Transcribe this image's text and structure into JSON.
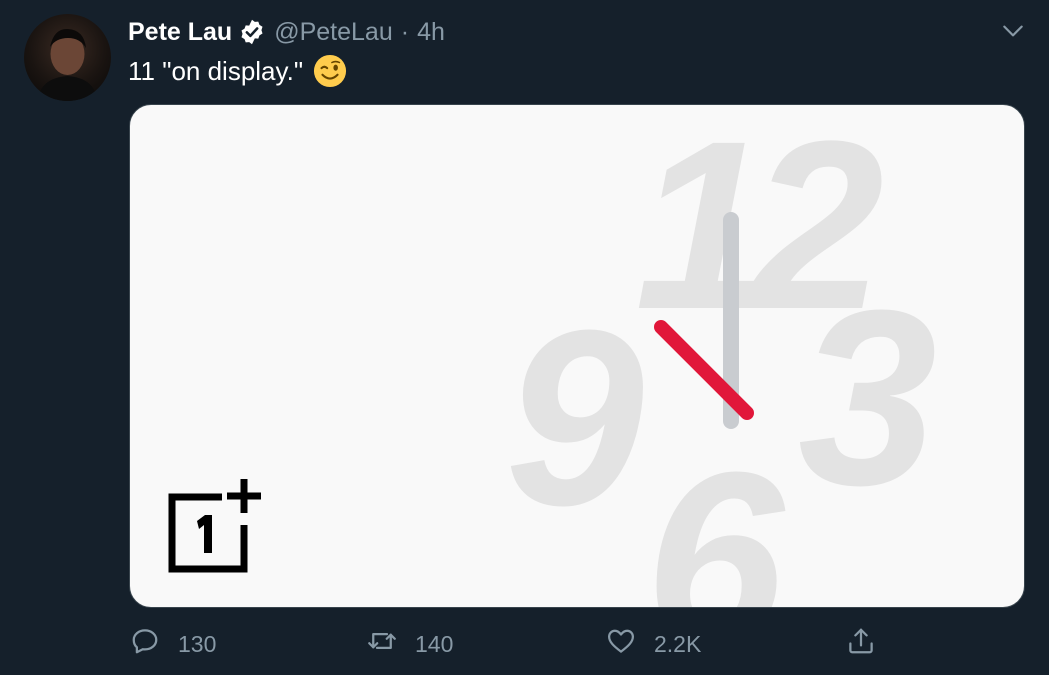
{
  "tweet": {
    "display_name": "Pete Lau",
    "verified": true,
    "handle": "@PeteLau",
    "separator": "·",
    "time": "4h",
    "text": "11 \"on display.\"",
    "emoji": "winking-face",
    "icons": {
      "verified": "verified-badge-icon",
      "more": "chevron-down-icon"
    }
  },
  "media": {
    "clock_numbers": [
      "12",
      "9",
      "3",
      "6"
    ],
    "logo": "oneplus-logo",
    "logo_text": "1+",
    "clock_time_shown": "11:00",
    "colors": {
      "background": "#f9f9f9",
      "numbers": "#e3e3e3",
      "minute_hand": "#c9ccd0",
      "hour_hand": "#e1173a"
    }
  },
  "actions": {
    "reply": {
      "icon": "reply-icon",
      "count": "130"
    },
    "retweet": {
      "icon": "retweet-icon",
      "count": "140"
    },
    "like": {
      "icon": "heart-icon",
      "count": "2.2K"
    },
    "share": {
      "icon": "share-icon"
    }
  },
  "colors": {
    "background": "#15202b",
    "text_primary": "#ffffff",
    "text_secondary": "#8899a6",
    "verified": "#ffffff"
  }
}
